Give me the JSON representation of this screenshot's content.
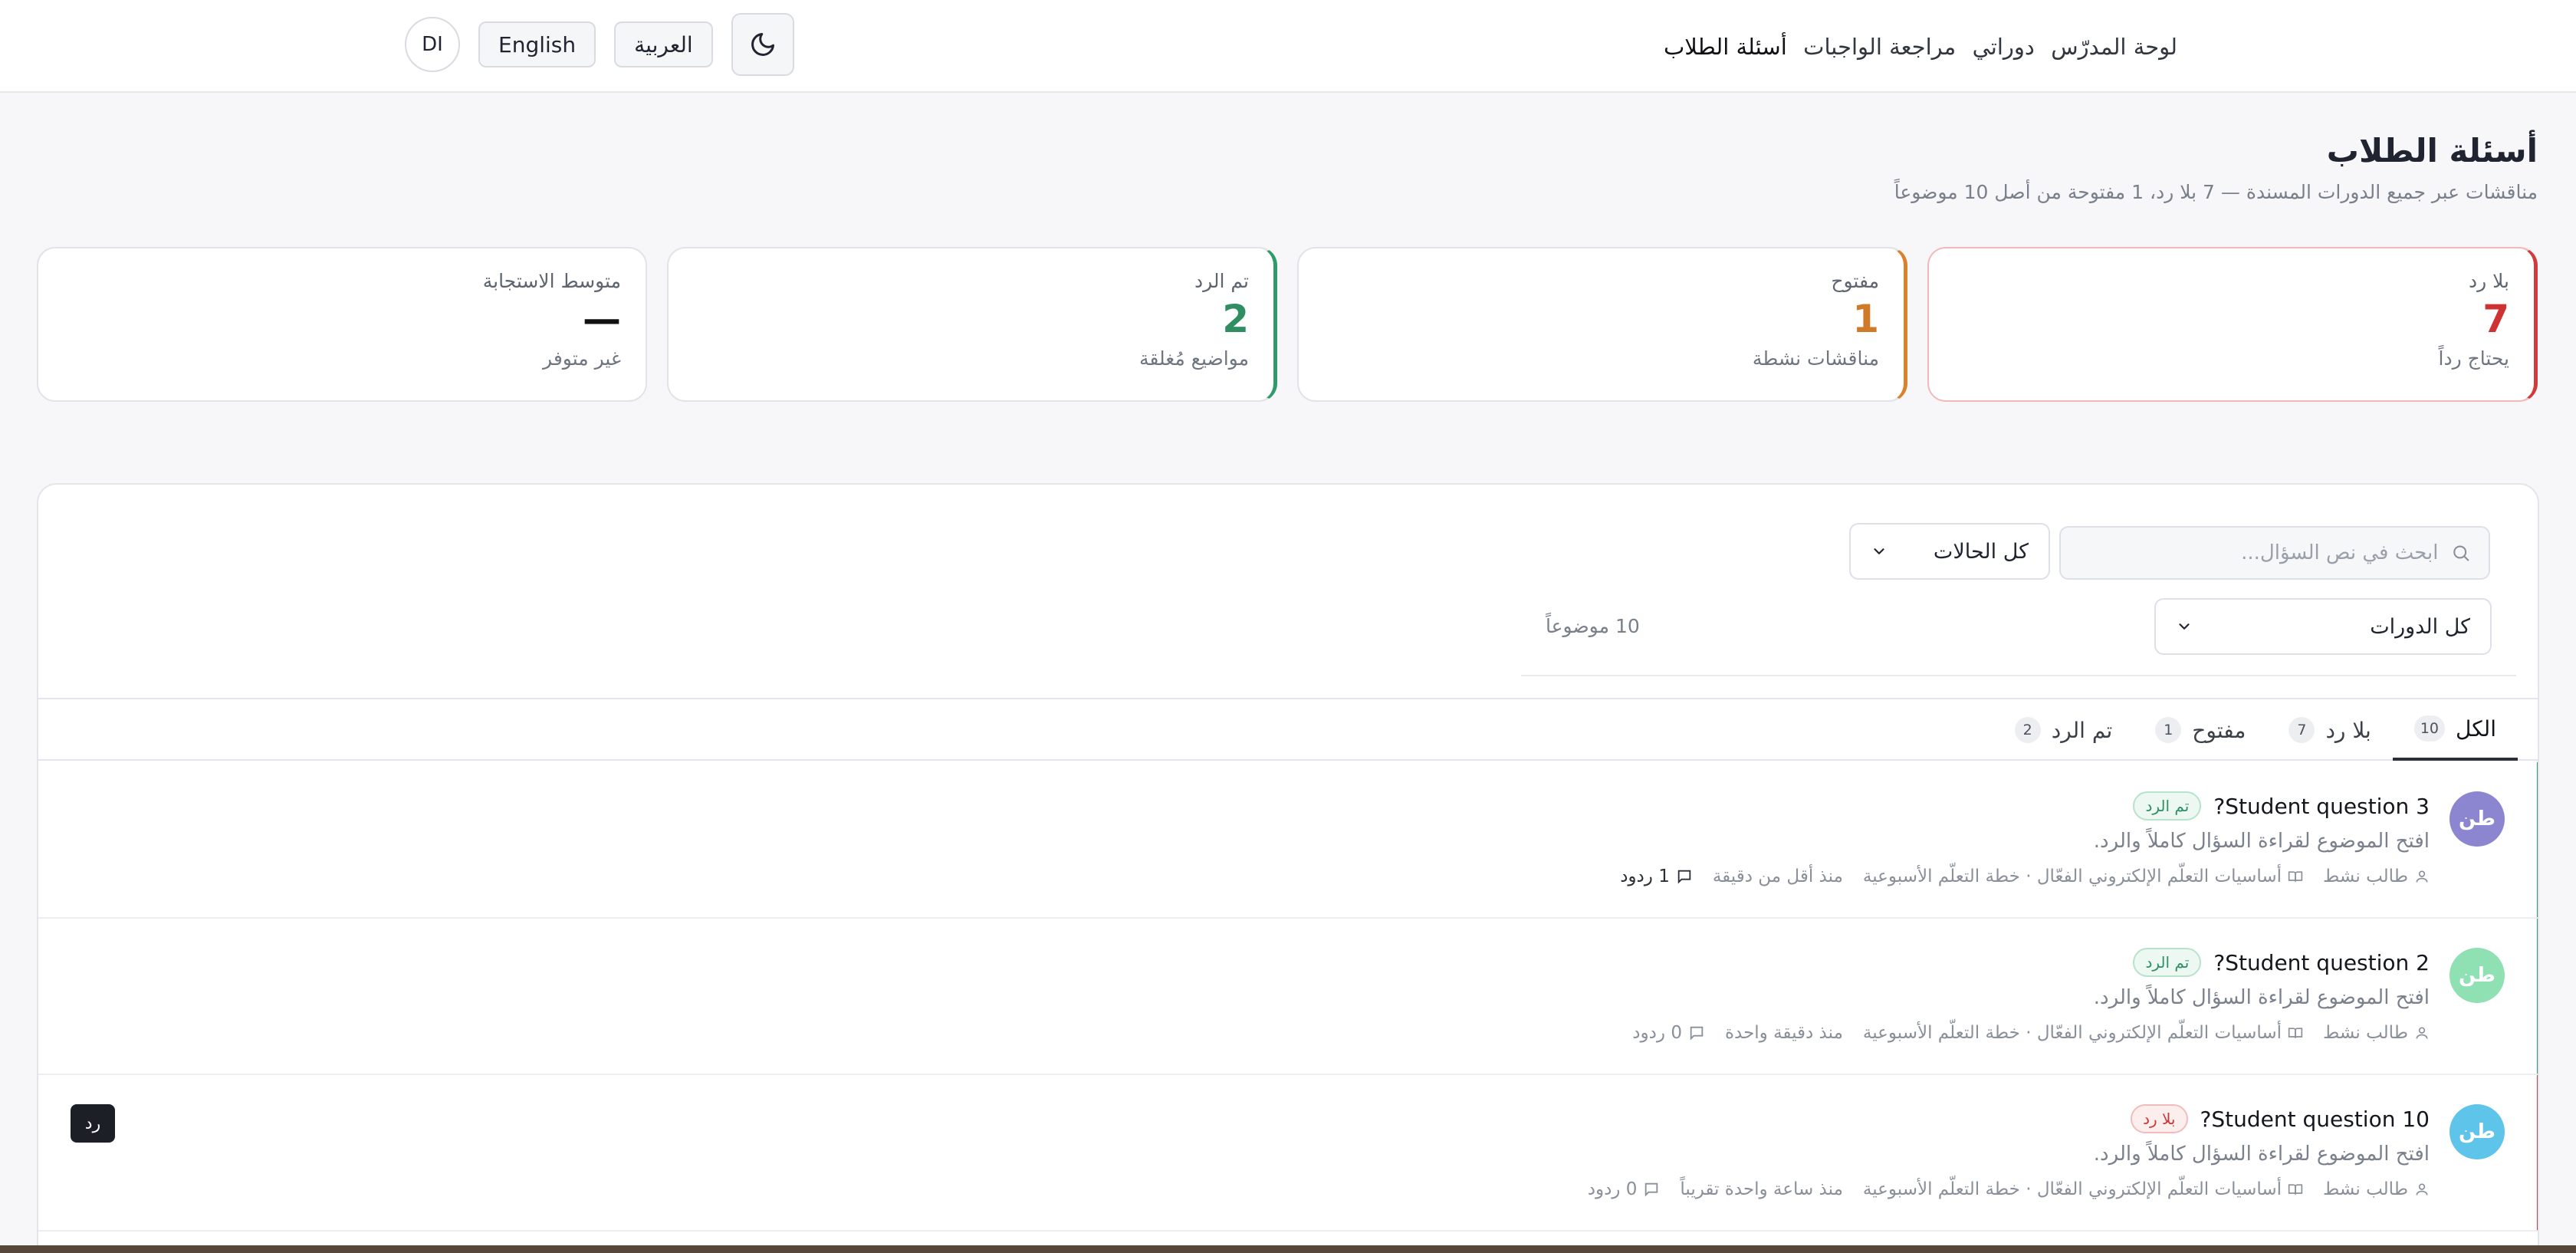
{
  "nav": {
    "links": [
      "لوحة المدرّس",
      "دوراتي",
      "مراجعة الواجبات",
      "أسئلة الطلاب"
    ],
    "active_index": 3,
    "avatar": "DI",
    "lang_en": "English",
    "lang_ar": "العربية",
    "theme_icon": "moon-icon"
  },
  "page": {
    "title": "أسئلة الطلاب",
    "subtitle": "مناقشات عبر جميع الدورات المسندة — 7 بلا رد، 1 مفتوحة من أصل 10 موضوعاً"
  },
  "stats": [
    {
      "label": "بلا رد",
      "value": "7",
      "hint": "يحتاج رداً",
      "color": "#cf3232"
    },
    {
      "label": "مفتوح",
      "value": "1",
      "hint": "مناقشات نشطة",
      "color": "#cf7a26"
    },
    {
      "label": "تم الرد",
      "value": "2",
      "hint": "مواضيع مُغلقة",
      "color": "#2f8f63"
    },
    {
      "label": "متوسط الاستجابة",
      "value": "—",
      "hint": "غير متوفر",
      "color": "#111111"
    }
  ],
  "filters": {
    "search_placeholder": "ابحث في نص السؤال...",
    "status_select": "كل الحالات",
    "course_select": "كل الدورات",
    "topic_count": "10 موضوعاً"
  },
  "tabs": [
    {
      "label": "الكل",
      "count": "10"
    },
    {
      "label": "بلا رد",
      "count": "7"
    },
    {
      "label": "مفتوح",
      "count": "1"
    },
    {
      "label": "تم الرد",
      "count": "2"
    }
  ],
  "questions": [
    {
      "avatar": "طن",
      "avatar_color": "#8c86d0",
      "title": "Student question 3?",
      "status": "تم الرد",
      "status_type": "green",
      "preview": "افتح الموضوع لقراءة السؤال كاملاً والرد.",
      "student": "طالب نشط",
      "course": "أساسيات التعلّم الإلكتروني الفعّال · خطة التعلّم الأسبوعية",
      "time": "منذ أقل من دقيقة",
      "replies": "1 ردود"
    },
    {
      "avatar": "طن",
      "avatar_color": "#8fe1b3",
      "title": "Student question 2?",
      "status": "تم الرد",
      "status_type": "green",
      "preview": "افتح الموضوع لقراءة السؤال كاملاً والرد.",
      "student": "طالب نشط",
      "course": "أساسيات التعلّم الإلكتروني الفعّال · خطة التعلّم الأسبوعية",
      "time": "منذ دقيقة واحدة",
      "replies": "0 ردود"
    },
    {
      "avatar": "طن",
      "avatar_color": "#5ec4ea",
      "title": "Student question 10?",
      "status": "بلا رد",
      "status_type": "red",
      "preview": "افتح الموضوع لقراءة السؤال كاملاً والرد.",
      "student": "طالب نشط",
      "course": "أساسيات التعلّم الإلكتروني الفعّال · خطة التعلّم الأسبوعية",
      "time": "منذ ساعة واحدة تقريباً",
      "replies": "0 ردود",
      "reply_button": "رد"
    }
  ]
}
